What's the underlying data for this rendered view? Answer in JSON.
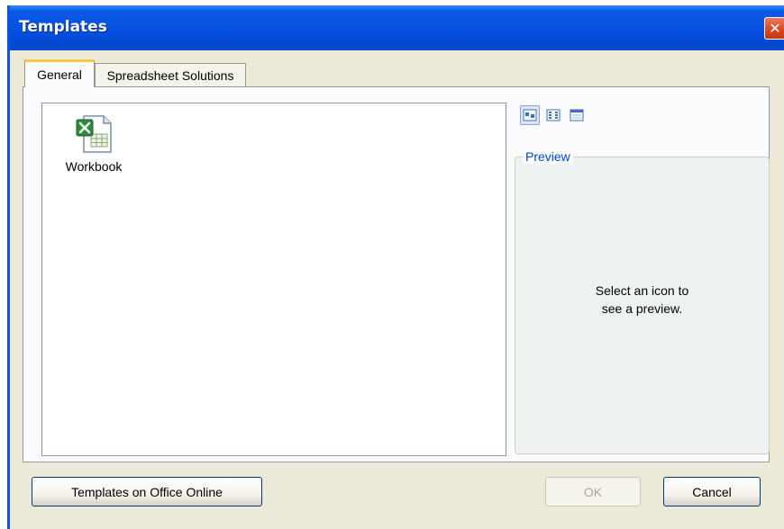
{
  "window": {
    "title": "Templates",
    "close_symbol": "✕"
  },
  "tabs": [
    {
      "label": "General",
      "active": true
    },
    {
      "label": "Spreadsheet Solutions",
      "active": false
    }
  ],
  "files": [
    {
      "label": "Workbook",
      "icon": "excel-workbook-icon"
    }
  ],
  "view_buttons": [
    {
      "icon": "large-icons-view-icon",
      "selected": true
    },
    {
      "icon": "list-view-icon",
      "selected": false
    },
    {
      "icon": "details-view-icon",
      "selected": false
    }
  ],
  "preview": {
    "legend": "Preview",
    "message_line1": "Select an icon to",
    "message_line2": "see a preview."
  },
  "buttons": {
    "office_online": "Templates on Office Online",
    "ok": "OK",
    "cancel": "Cancel"
  },
  "colors": {
    "titlebar": "#0551e0",
    "dialog_bg": "#ece9d8",
    "active_tab_accent": "#ffc73c",
    "preview_legend": "#0046d5"
  }
}
